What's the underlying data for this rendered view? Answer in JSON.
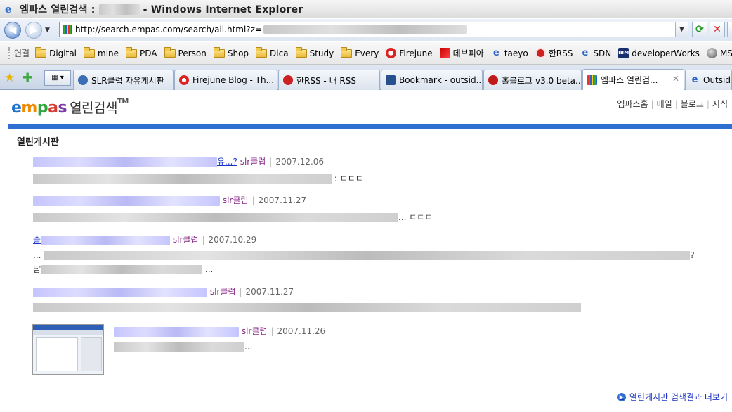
{
  "window": {
    "title_prefix": "엠파스 열린검색 : ",
    "title_suffix": " - Windows Internet Explorer"
  },
  "address_bar": {
    "url": "http://search.empas.com/search/all.html?z="
  },
  "links_bar": {
    "label": "연결",
    "items": [
      {
        "label": "Digital",
        "icon": "folder-icon"
      },
      {
        "label": "mine",
        "icon": "folder-icon"
      },
      {
        "label": "PDA",
        "icon": "folder-icon"
      },
      {
        "label": "Person",
        "icon": "folder-icon"
      },
      {
        "label": "Shop",
        "icon": "folder-icon"
      },
      {
        "label": "Dica",
        "icon": "folder-icon"
      },
      {
        "label": "Study",
        "icon": "folder-icon"
      },
      {
        "label": "Every",
        "icon": "folder-icon"
      },
      {
        "label": "Firejune",
        "icon": "firejune-icon"
      },
      {
        "label": "데브피아",
        "icon": "devpia-icon"
      },
      {
        "label": "taeyo",
        "icon": "ie-page-icon"
      },
      {
        "label": "한RSS",
        "icon": "rss-icon"
      },
      {
        "label": "SDN",
        "icon": "ie-page-icon"
      },
      {
        "label": "developerWorks",
        "icon": "ibm-icon"
      },
      {
        "label": "MSD",
        "icon": "msdn-icon"
      }
    ]
  },
  "tabs": [
    {
      "label": "SLR클럽 자유게시판",
      "color": "#3b6fb3"
    },
    {
      "label": "Firejune Blog - Th...",
      "color": "#d22222"
    },
    {
      "label": "한RSS - 내 RSS",
      "color": "#c22222"
    },
    {
      "label": "Bookmark - outsid...",
      "color": "#27508f"
    },
    {
      "label": "홀블로그 v3.0 beta...",
      "color": "#c01a1a"
    },
    {
      "label": "엠파스 열린검...",
      "color": "#e03a2a"
    },
    {
      "label": "Outside",
      "color": "#2a62c8"
    }
  ],
  "page": {
    "logo_kr": "열린검색",
    "logo_tm": "TM",
    "top_nav": [
      "엠파스홈",
      "메일",
      "블로그",
      "지식"
    ],
    "section_title": "열린게시판",
    "results": [
      {
        "title_end": "유...?",
        "source": "slr클럽",
        "date": "2007.12.06",
        "snippet_end": ": ㄷㄷㄷ"
      },
      {
        "title_end": "",
        "source": "slr클럽",
        "date": "2007.11.27",
        "snippet_end": "... ㄷㄷㄷ"
      },
      {
        "title_start": "줄",
        "source": "slr클럽",
        "date": "2007.10.29",
        "snippet_start": "...",
        "snippet_end": "?",
        "snippet2_start": "남",
        "snippet2_end": "..."
      },
      {
        "title_end": "",
        "source": "slr클럽",
        "date": "2007.11.27",
        "snippet_end": ""
      },
      {
        "title_end": "",
        "source": "slr클럽",
        "date": "2007.11.26",
        "snippet_end": "..."
      }
    ],
    "more_link": "열린게시판 검색결과 더보기"
  }
}
